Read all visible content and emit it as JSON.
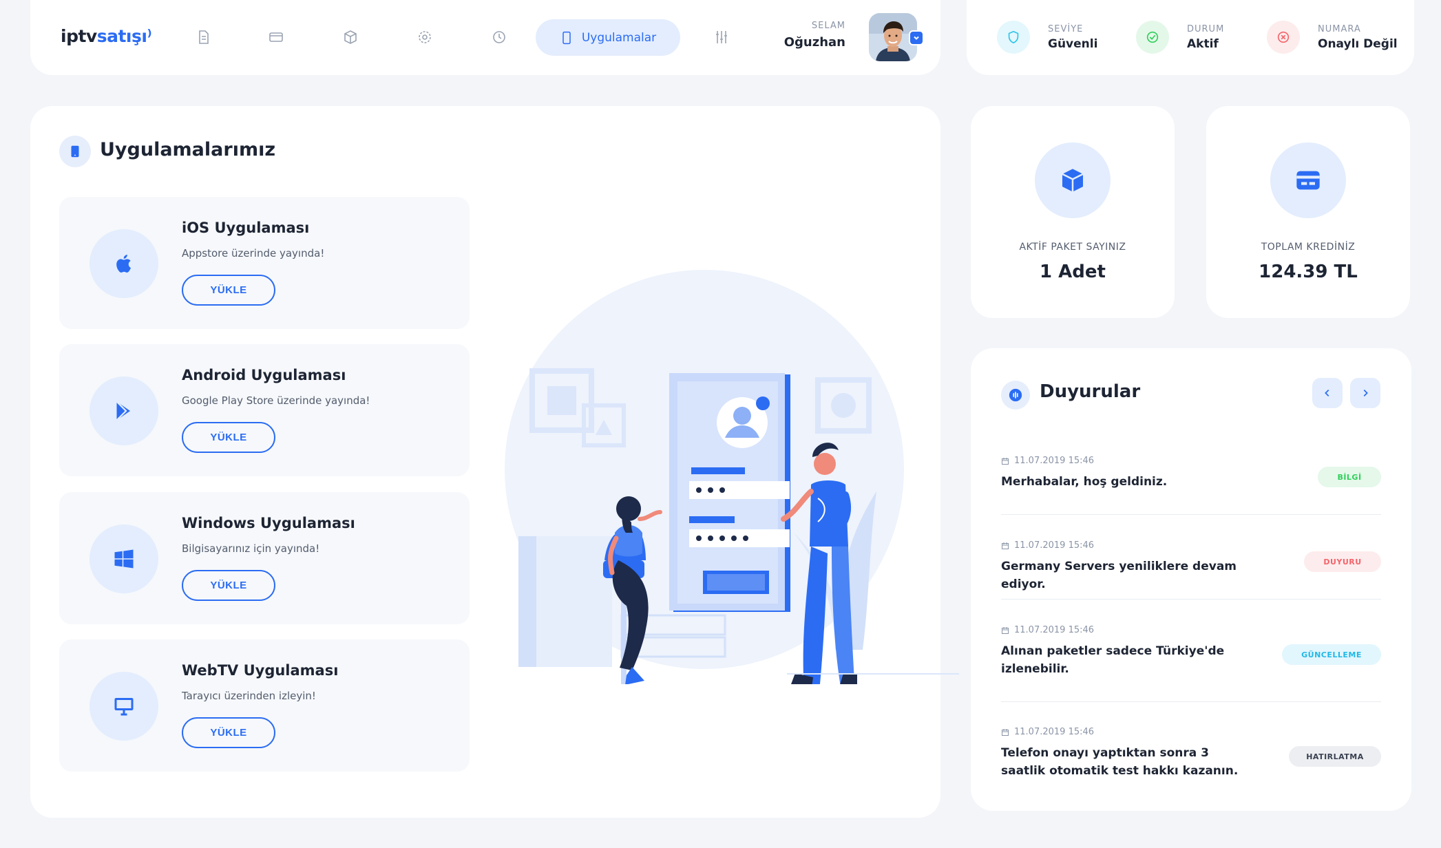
{
  "nav": {
    "logo_part1": "iptv",
    "logo_part2": "satışı",
    "active_label": "Uygulamalar",
    "greeting_label": "SELAM",
    "user_name": "Oğuzhan"
  },
  "status": [
    {
      "label": "SEVİYE",
      "value": "Güvenli",
      "color": "#2ec4e8",
      "icon": "shield-icon"
    },
    {
      "label": "DURUM",
      "value": "Aktif",
      "color": "#2fcf59",
      "icon": "check-circle-icon"
    },
    {
      "label": "NUMARA",
      "value": "Onaylı Değil",
      "color": "#f2646a",
      "icon": "x-circle-icon"
    }
  ],
  "main": {
    "title": "Uygulamalarımız",
    "apps": [
      {
        "title": "iOS Uygulaması",
        "desc": "Appstore üzerinde yayında!",
        "button": "YÜKLE",
        "icon": "apple-icon"
      },
      {
        "title": "Android Uygulaması",
        "desc": "Google Play Store üzerinde yayında!",
        "button": "YÜKLE",
        "icon": "play-store-icon"
      },
      {
        "title": "Windows Uygulaması",
        "desc": "Bilgisayarınız için yayında!",
        "button": "YÜKLE",
        "icon": "windows-icon"
      },
      {
        "title": "WebTV Uygulaması",
        "desc": "Tarayıcı üzerinden izleyin!",
        "button": "YÜKLE",
        "icon": "monitor-icon"
      }
    ]
  },
  "stats": [
    {
      "label": "AKTİF PAKET SAYINIZ",
      "value": "1 Adet",
      "icon": "box-icon"
    },
    {
      "label": "TOPLAM KREDİNİZ",
      "value": "124.39 TL",
      "icon": "credit-card-icon"
    }
  ],
  "announcements": {
    "title": "Duyurular",
    "items": [
      {
        "date": "11.07.2019 15:46",
        "text": "Merhabalar, hoş geldiniz.",
        "badge": "BİLGİ",
        "badge_color": "#2fcf59",
        "badge_bg": "#e5f8ea"
      },
      {
        "date": "11.07.2019 15:46",
        "text": "Germany Servers yeniliklere devam ediyor.",
        "badge": "DUYURU",
        "badge_color": "#f2646a",
        "badge_bg": "#fdeced"
      },
      {
        "date": "11.07.2019 15:46",
        "text": "Alınan paketler sadece Türkiye'de izlenebilir.",
        "badge": "GÜNCELLEME",
        "badge_color": "#22b8e6",
        "badge_bg": "#e2f6fd"
      },
      {
        "date": "11.07.2019 15:46",
        "text": "Telefon onayı yaptıktan sonra 3 saatlik otomatik test hakkı kazanın.",
        "badge": "HATIRLATMA",
        "badge_color": "#3a4150",
        "badge_bg": "#eceef1"
      }
    ]
  }
}
